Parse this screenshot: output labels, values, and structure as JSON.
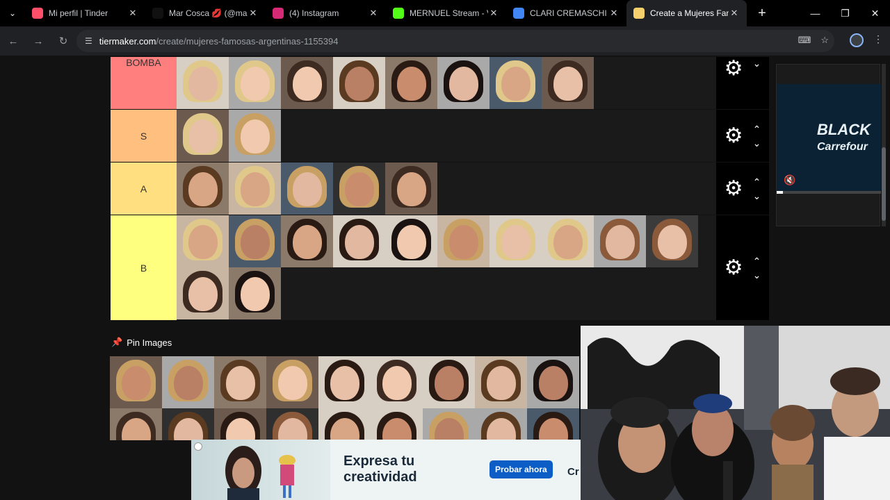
{
  "browser": {
    "tabs": [
      {
        "label": "Mi perfil | Tinder",
        "favicon": "tinder-icon",
        "color": "#fd5068",
        "active": false
      },
      {
        "label": "Mar Cosca 💋 (@maa",
        "favicon": "tiktok-icon",
        "color": "#111111",
        "active": false
      },
      {
        "label": "(4) Instagram",
        "favicon": "instagram-icon",
        "color": "#d62976",
        "active": false
      },
      {
        "label": "MERNUEL Stream - V",
        "favicon": "kick-icon",
        "color": "#53fc18",
        "active": false
      },
      {
        "label": "CLARI CREMASCHI -",
        "favicon": "google-icon",
        "color": "#4285f4",
        "active": false
      },
      {
        "label": "Create a Mujeres Fam",
        "favicon": "tiermaker-icon",
        "color": "#f6d06c",
        "active": true
      }
    ],
    "url_host": "tiermaker.com",
    "url_path": "/create/mujeres-famosas-argentinas-1155394"
  },
  "tiers": [
    {
      "label": "BOMBA",
      "color": "#ff7f7f",
      "count": 8
    },
    {
      "label": "S",
      "color": "#ffbf7f",
      "count": 2
    },
    {
      "label": "A",
      "color": "#ffdf7f",
      "count": 5
    },
    {
      "label": "B",
      "color": "#ffff7f",
      "count": 12
    }
  ],
  "pin_images": {
    "label": "Pin Images",
    "count": 18
  },
  "side_ad": {
    "line1": "BLACK",
    "line2": "Carrefour",
    "progress": 0.06
  },
  "bottom_ad": {
    "headline_1": "Expresa tu",
    "headline_2": "creatividad",
    "cta": "Probar ahora",
    "cut_text": "Cr"
  }
}
